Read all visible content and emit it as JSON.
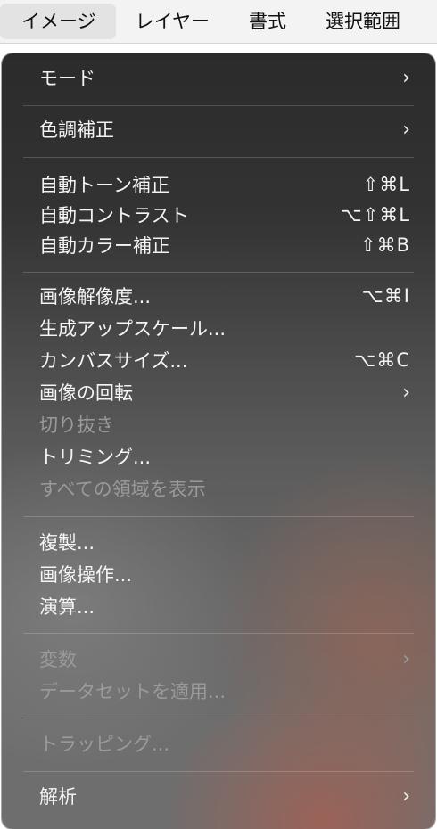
{
  "menubar": {
    "items": [
      "イメージ",
      "レイヤー",
      "書式",
      "選択範囲"
    ]
  },
  "menu": {
    "items": [
      {
        "label": "モード",
        "submenu": true,
        "chevron": "›"
      },
      {
        "label": "色調補正",
        "submenu": true,
        "chevron": "›"
      },
      {
        "label": "自動トーン補正",
        "shortcut": "⇧⌘L"
      },
      {
        "label": "自動コントラスト",
        "shortcut": "⌥⇧⌘L"
      },
      {
        "label": "自動カラー補正",
        "shortcut": "⇧⌘B"
      },
      {
        "label": "画像解像度...",
        "shortcut": "⌥⌘I"
      },
      {
        "label": "生成アップスケール..."
      },
      {
        "label": "カンバスサイズ...",
        "shortcut": "⌥⌘C"
      },
      {
        "label": "画像の回転",
        "submenu": true,
        "chevron": "›"
      },
      {
        "label": "切り抜き",
        "disabled": true
      },
      {
        "label": "トリミング..."
      },
      {
        "label": "すべての領域を表示",
        "disabled": true
      },
      {
        "label": "複製..."
      },
      {
        "label": "画像操作..."
      },
      {
        "label": "演算..."
      },
      {
        "label": "変数",
        "submenu": true,
        "disabled": true,
        "chevron": "›"
      },
      {
        "label": "データセットを適用...",
        "disabled": true
      },
      {
        "label": "トラッピング...",
        "disabled": true
      },
      {
        "label": "解析",
        "submenu": true,
        "chevron": "›"
      }
    ]
  }
}
